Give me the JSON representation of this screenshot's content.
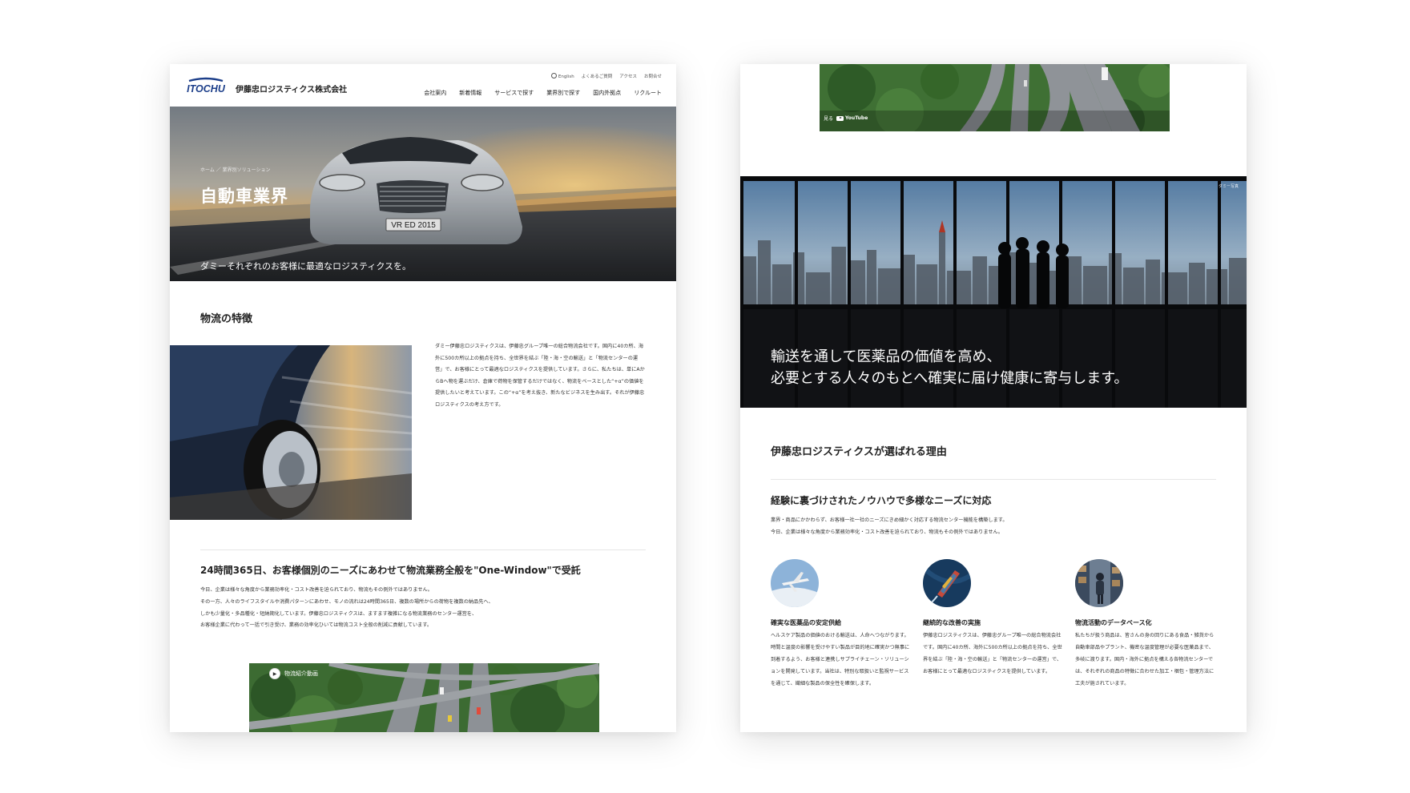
{
  "left_page": {
    "header": {
      "logo_text": "ITOCHU",
      "company_name": "伊藤忠ロジスティクス株式会社",
      "utility_links": [
        "English",
        "よくあるご質問",
        "アクセス",
        "お問合せ"
      ],
      "nav_items": [
        "会社案内",
        "新着情報",
        "サービスで探す",
        "業界別で探す",
        "国内外拠点",
        "リクルート"
      ]
    },
    "hero": {
      "breadcrumb": "ホーム ／ 業界別ソリューション",
      "title": "自動車業界",
      "subtitle": "ダミーそれぞれのお客様に最適なロジスティクスを。",
      "plate_text": "VR ED 2015"
    },
    "section1": {
      "title": "物流の特徴",
      "paragraph": "ダミー伊藤忠ロジスティクスは、伊藤忠グループ唯一の総合物流会社です。国内に40カ所、海外に500カ所以上の拠点を持ち、全世界を結ぶ「陸・海・空の輸送」と「物流センターの運営」で、お客様にとって最適なロジスティクスを提供しています。さらに、私たちは、単にAからBへ物を運ぶだけ、倉庫で荷物を保管するだけではなく、物流をベースとした“+α”の価値を提供したいと考えています。この“+α”を考え抜き、新たなビジネスを生み出す。それが伊藤忠ロジスティクスの考え方です。"
    },
    "section2": {
      "title": "24時間365日、お客様個別のニーズにあわせて物流業務全般を\"One-Window\"で受託",
      "lines": [
        "今日、企業は様々な角度から業務効率化・コスト改善を迫られており、物流もその例外ではありません。",
        "その一方、人々のライフスタイルや消費パターンにあわせ、モノの流れは24時間365日、複数の場所からの荷物を複数の納品先へ、",
        "しかも少量化・多品種化・短納期化しています。伊藤忠ロジスティクスは、ますます複雑になる物流業務のセンター運営を、",
        "お客様企業に代わって一括で引き受け、業務の効率化ひいては物流コスト全般の削減に貢献しています。"
      ]
    },
    "video": {
      "label": "物流紹介動画"
    }
  },
  "right_page": {
    "video": {
      "watch_label": "見る",
      "youtube_label": "YouTube"
    },
    "city": {
      "dummy_label": "ダミー写真",
      "caption_lines": [
        "輸送を通して医薬品の価値を高め、",
        "必要とする人々のもとへ確実に届け健康に寄与します。"
      ]
    },
    "reasons": {
      "title": "伊藤忠ロジスティクスが選ばれる理由",
      "subtitle": "経験に裏づけされたノウハウで多様なニーズに対応",
      "lines": [
        "業界・商品にかかわらず、お客様一社一社のニーズにきめ細かく対応する物流センター機能を構築します。",
        "今日、企業は様々な角度から業務効率化・コスト改善を迫られており、物流もその例外ではありません。"
      ]
    },
    "features": [
      {
        "icon": "airplane-icon",
        "title": "確実な医薬品の安定供給",
        "text": "ヘルスケア製品の価値のおける輸送は、人命へつながります。時間と温度の影響を受けやすい製品が目的地に確実かつ無事に到着するよう、お客様と連携しサプライチェーン・ソリューションを開発しています。当社は、特別な取扱いと監視サービスを通じて、繊細な製品の保全性を確保します。"
      },
      {
        "icon": "cargo-ship-icon",
        "title": "継続的な改善の実施",
        "text": "伊藤忠ロジスティクスは、伊藤忠グループ唯一の総合物流会社です。国内に40カ所、海外に500カ所以上の拠点を持ち、全世界を結ぶ「陸・海・空の輸送」と「物流センターの運営」で、お客様にとって最適なロジスティクスを提供しています。"
      },
      {
        "icon": "warehouse-worker-icon",
        "title": "物流活動のデータベース化",
        "text": "私たちが扱う商品は、皆さんの身の回りにある食品・雑貨から自動車部品やプラント、機密な温度管理が必要な医薬品まで、多岐に渡ります。国内・海外に拠点を構える各物流センターでは、それぞれの商品の特徴に合わせた加工・梱包・管理方法に工夫が施されています。"
      }
    ]
  }
}
